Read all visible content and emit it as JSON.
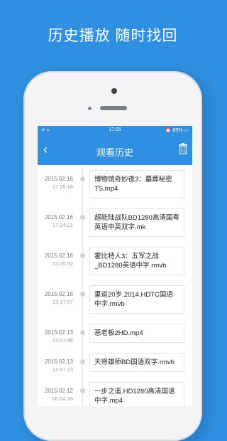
{
  "tagline": "历史播放  随时找回",
  "status": {
    "left": "✈ ≈",
    "time": "17:25",
    "right": "⏰ 85% ▭"
  },
  "nav": {
    "back": "‹",
    "title": "观看历史"
  },
  "history": [
    {
      "date": "2015.02.16",
      "time": "17:25:18",
      "title": "博物馆奇妙夜3：墓葬秘密TS.mp4"
    },
    {
      "date": "2015.02.16",
      "time": "17:24:21",
      "title": "超能陆战队BD1280高清国粤英语中英双字.mk"
    },
    {
      "date": "2015.02.16",
      "time": "13:20:32",
      "title": "霍比特人3：五军之战_BD1280英语中字.rmvb"
    },
    {
      "date": "2015.02.16",
      "time": "13:17:57",
      "title": "重返20岁.2014.HDTC国语中字.rmvb"
    },
    {
      "date": "2015.02.13",
      "time": "15:01:46",
      "title": "恶老板2HD.mp4"
    },
    {
      "date": "2015.02.13",
      "time": "14:57:23",
      "title": "天将雄师BD国语双字.rmvb"
    },
    {
      "date": "2015.02.12",
      "time": "00:04:26",
      "title": "一步之遥.HD1280高清国语中字.mp4"
    }
  ]
}
